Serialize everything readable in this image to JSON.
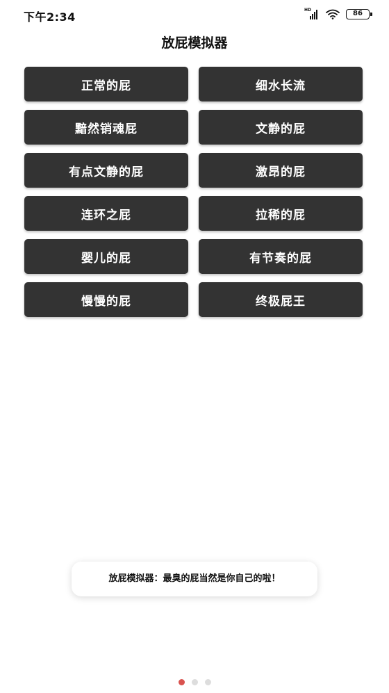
{
  "status_bar": {
    "time": "下午2:34",
    "network_label": "HD",
    "battery_level": "86",
    "icons": [
      "signal-icon",
      "wifi-icon",
      "battery-icon"
    ]
  },
  "page": {
    "title": "放屁模拟器"
  },
  "buttons": [
    {
      "label": "正常的屁"
    },
    {
      "label": "细水长流"
    },
    {
      "label": "黯然销魂屁"
    },
    {
      "label": "文静的屁"
    },
    {
      "label": "有点文静的屁"
    },
    {
      "label": "激昂的屁"
    },
    {
      "label": "连环之屁"
    },
    {
      "label": "拉稀的屁"
    },
    {
      "label": "婴儿的屁"
    },
    {
      "label": "有节奏的屁"
    },
    {
      "label": "慢慢的屁"
    },
    {
      "label": "终极屁王"
    }
  ],
  "toast": {
    "text": "放屁模拟器：最臭的屁当然是你自己的啦！"
  },
  "page_indicator": {
    "total": 3,
    "active_index": 0
  },
  "colors": {
    "button_background": "#333333",
    "button_text": "#ffffff",
    "active_dot": "#d9534f",
    "inactive_dot": "#dddddd"
  }
}
